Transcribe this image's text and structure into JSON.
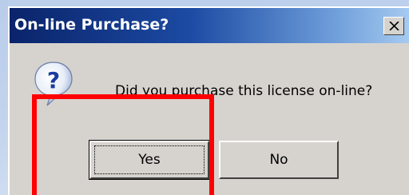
{
  "dialog": {
    "title": "On-line Purchase?",
    "message": "Did you purchase this license on-line?",
    "icon": "question-icon",
    "close_icon": "close-icon",
    "buttons": {
      "yes_label": "Yes",
      "no_label": "No"
    }
  },
  "colors": {
    "titlebar_start": "#0a246a",
    "titlebar_end": "#a6caf0",
    "dialog_background": "#d6d3ce",
    "highlight": "#ff0000"
  }
}
